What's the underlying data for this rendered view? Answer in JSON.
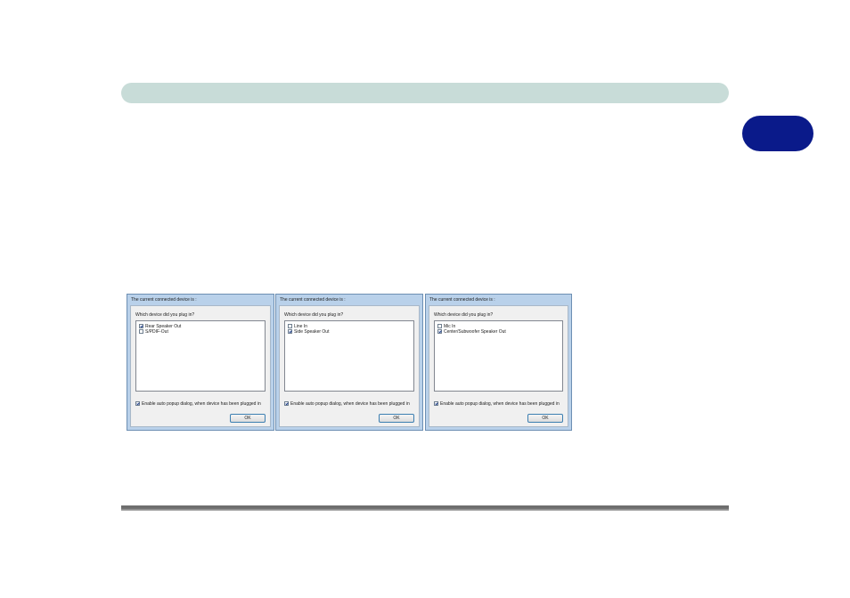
{
  "dialogs": [
    {
      "title": "The current connected device is :",
      "question": "Which device did you plug in?",
      "items": [
        {
          "label": "Rear Speaker Out",
          "checked": true
        },
        {
          "label": "S/PDIF-Out",
          "checked": false
        }
      ],
      "auto_popup": {
        "label": "Enable auto popup dialog, when device has been plugged in",
        "checked": true
      },
      "ok_label": "OK"
    },
    {
      "title": "The current connected device is :",
      "question": "Which device did you plug in?",
      "items": [
        {
          "label": "Line In",
          "checked": false
        },
        {
          "label": "Side Speaker Out",
          "checked": true
        }
      ],
      "auto_popup": {
        "label": "Enable auto popup dialog, when device has been plugged in",
        "checked": true
      },
      "ok_label": "OK"
    },
    {
      "title": "The current connected device is :",
      "question": "Which device did you plug in?",
      "items": [
        {
          "label": "Mic In",
          "checked": false
        },
        {
          "label": "Center/Subwoofer Speaker Out",
          "checked": true
        }
      ],
      "auto_popup": {
        "label": "Enable auto popup dialog, when device has been plugged in",
        "checked": true
      },
      "ok_label": "OK"
    }
  ],
  "colors": {
    "header_bar": "#c8dcd8",
    "chapter_tab": "#0a1a8a",
    "dialog_frame": "#b9d1ea"
  }
}
